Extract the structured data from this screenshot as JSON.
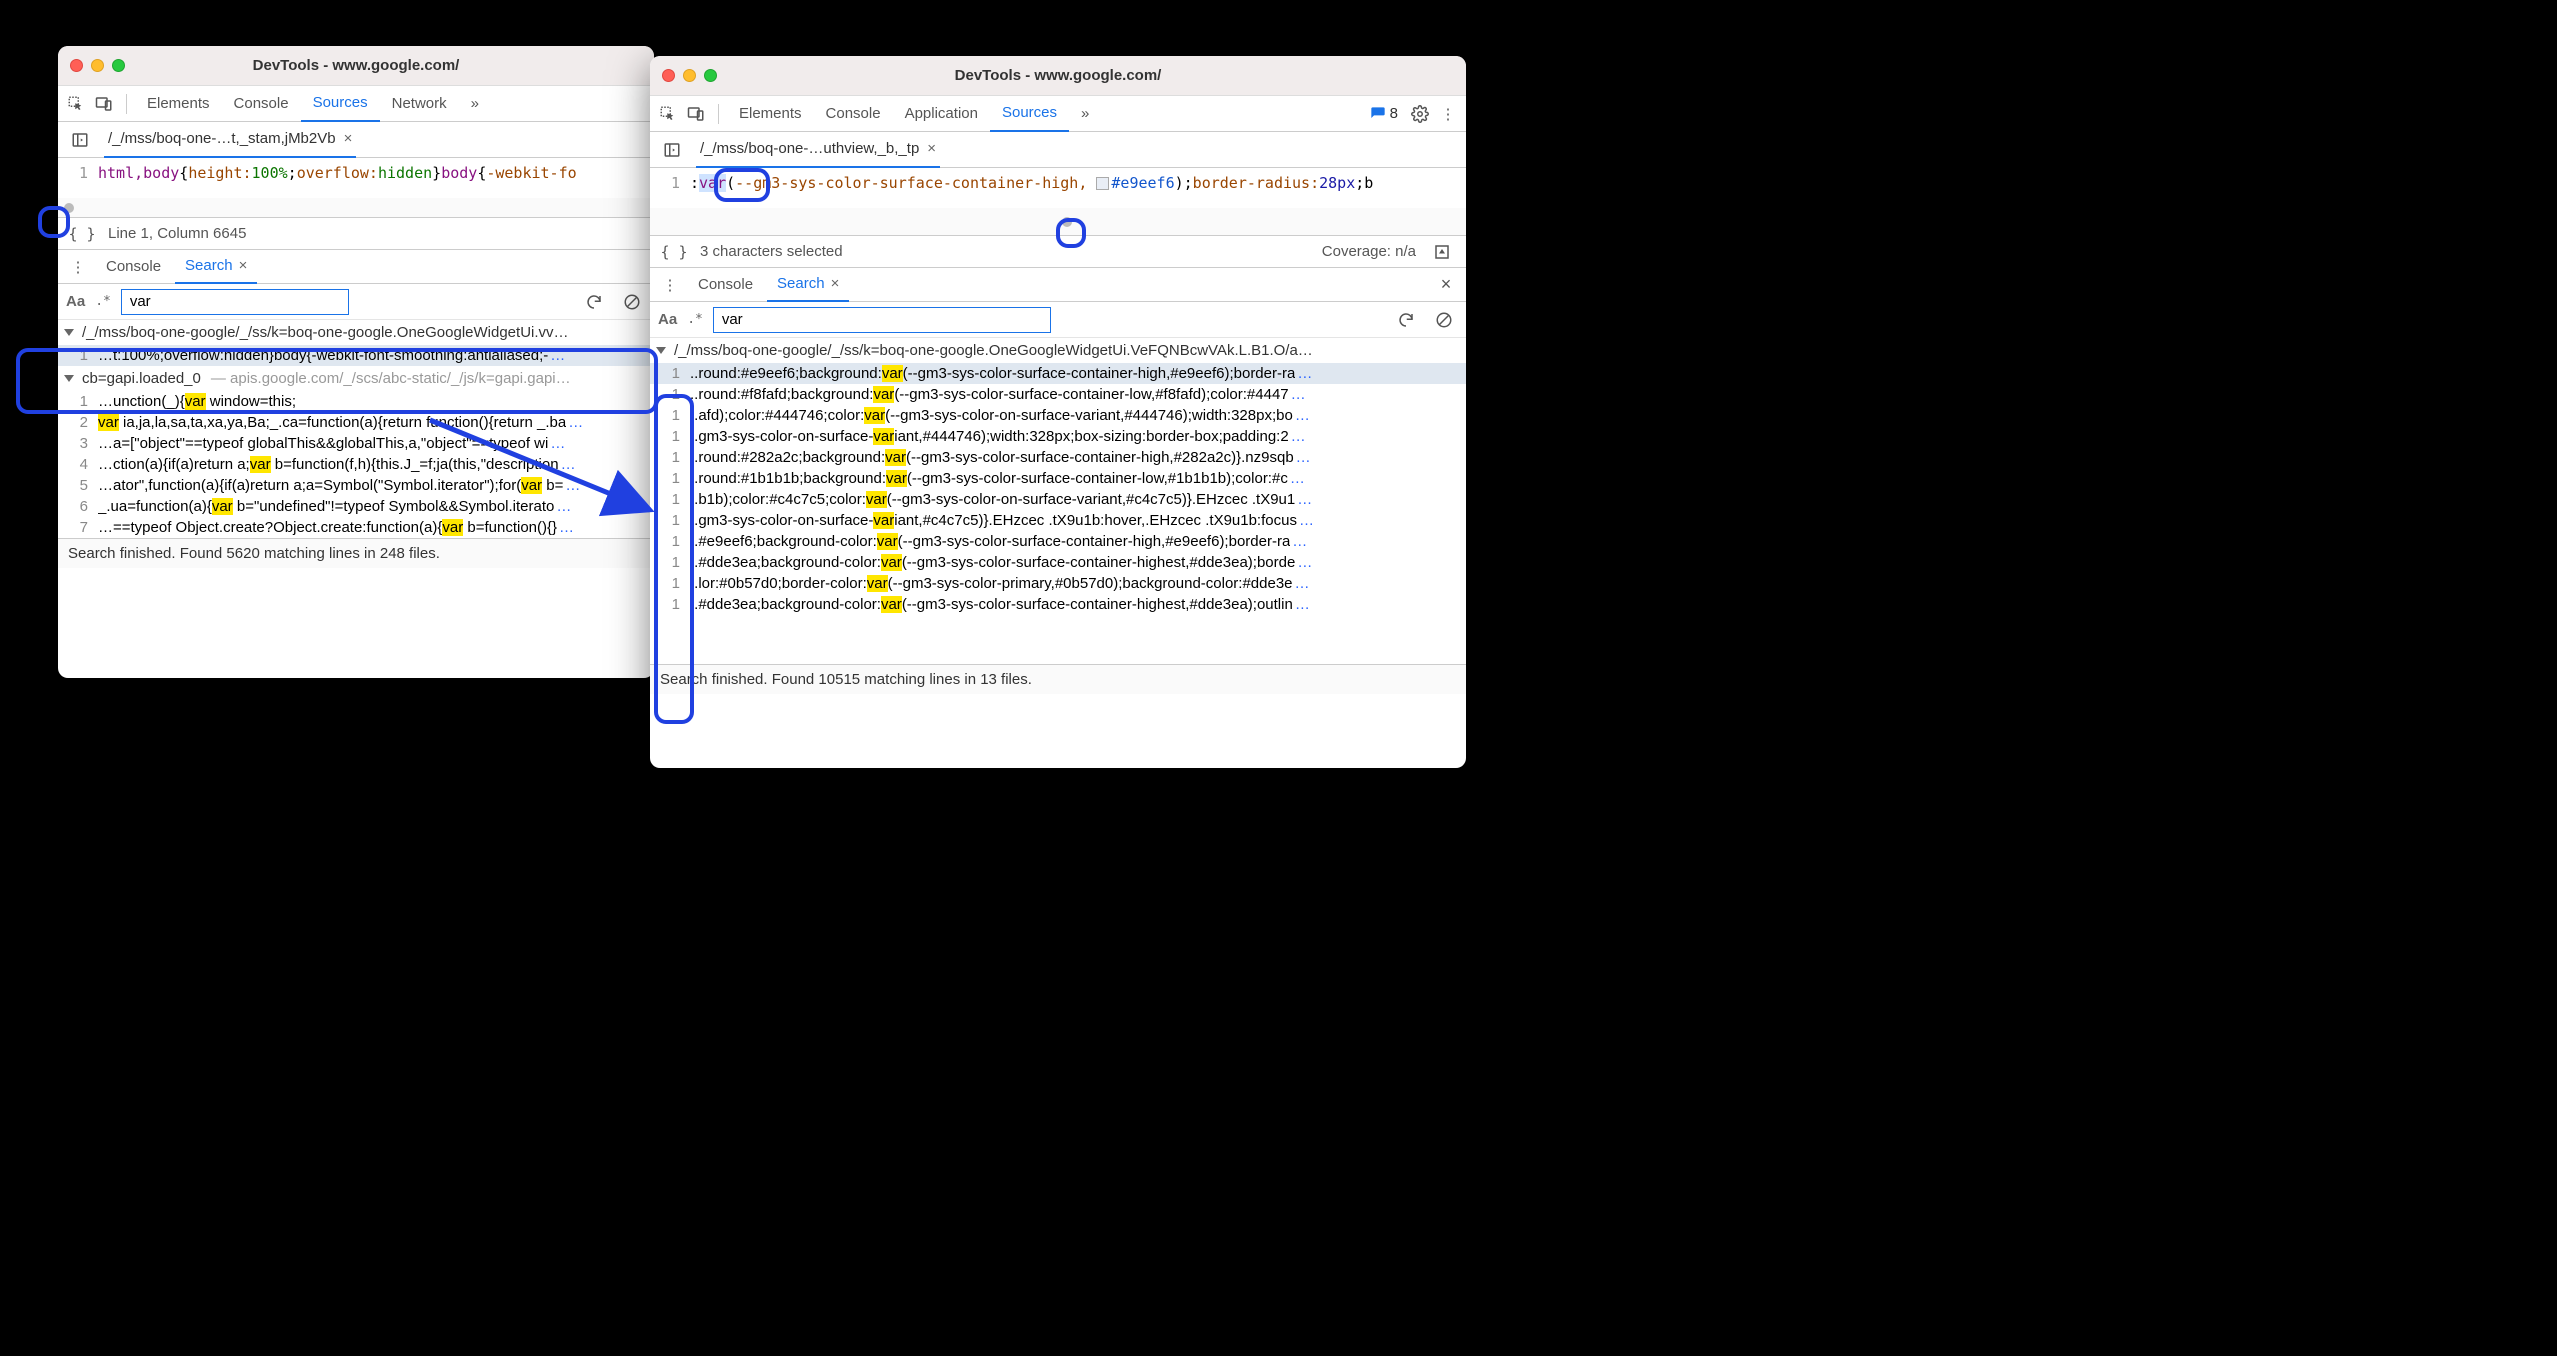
{
  "left": {
    "title": "DevTools - www.google.com/",
    "tabs": {
      "elements": "Elements",
      "console": "Console",
      "sources": "Sources",
      "network": "Network",
      "more": "»"
    },
    "file_tab": "/_/mss/boq-one-…t,_stam,jMb2Vb",
    "code": {
      "ln": "1",
      "seg_tag": "html,body",
      "seg_brace1": "{",
      "seg_prop1": "height:",
      "seg_val1": "100%",
      "seg_semi1": ";",
      "seg_prop2": "overflow:",
      "seg_val2": "hidden",
      "seg_brace2": "}",
      "seg_tag2": "body",
      "seg_brace3": "{",
      "seg_prop3": "-webkit-fo"
    },
    "status": "Line 1, Column 6645",
    "drawer": {
      "console": "Console",
      "search": "Search"
    },
    "search": {
      "Aa": "Aa",
      "regex": ".*",
      "value": "var"
    },
    "groups": [
      {
        "head": "/_/mss/boq-one-google/_/ss/k=boq-one-google.OneGoogleWidgetUi.vv…",
        "rows": [
          {
            "ln": "1",
            "pre": "…t:100%;overflow:hidden}body{-webkit-font-smoothing:antialiased;-",
            "hl": "",
            "post": "",
            "more": "…",
            "sel": true
          }
        ]
      },
      {
        "head": "cb=gapi.loaded_0",
        "sub": "— apis.google.com/_/scs/abc-static/_/js/k=gapi.gapi…",
        "rows": [
          {
            "ln": "1",
            "pre": "…unction(_){",
            "hl": "var",
            "post": " window=this;",
            "more": ""
          },
          {
            "ln": "2",
            "pre": "",
            "hl": "var",
            "post": " ia,ja,la,sa,ta,xa,ya,Ba;_.ca=function(a){return function(){return _.ba",
            "more": "…"
          },
          {
            "ln": "3",
            "pre": "…a=[\"object\"==typeof globalThis&&globalThis,a,\"object\"==typeof wi",
            "hl": "",
            "post": "",
            "more": "…"
          },
          {
            "ln": "4",
            "pre": "…ction(a){if(a)return a;",
            "hl": "var",
            "post": " b=function(f,h){this.J_=f;ja(this,\"description",
            "more": "…"
          },
          {
            "ln": "5",
            "pre": "…ator\",function(a){if(a)return a;a=Symbol(\"Symbol.iterator\");for(",
            "hl": "var",
            "post": " b=",
            "more": "…"
          },
          {
            "ln": "6",
            "pre": "_.ua=function(a){",
            "hl": "var",
            "post": " b=\"undefined\"!=typeof Symbol&&Symbol.iterato",
            "more": "…"
          },
          {
            "ln": "7",
            "pre": "…==typeof Object.create?Object.create:function(a){",
            "hl": "var",
            "post": " b=function(){}",
            "more": "…"
          }
        ]
      }
    ],
    "footer": "Search finished.  Found 5620 matching lines in 248 files."
  },
  "right": {
    "title": "DevTools - www.google.com/",
    "tabs": {
      "elements": "Elements",
      "console": "Console",
      "application": "Application",
      "sources": "Sources",
      "more": "»"
    },
    "badge_count": "8",
    "file_tab": "/_/mss/boq-one-…uthview,_b,_tp",
    "code": {
      "ln": "1",
      "pre": ":",
      "var": "var",
      "open": "(",
      "arg1": "--gm3-sys-color-surface-container-high, ",
      "hex": "#e9eef6",
      "close": ");",
      "prop": "border-radius:",
      "val": "28px",
      "tail": ";b"
    },
    "status_left": "3 characters selected",
    "status_right": "Coverage: n/a",
    "drawer": {
      "console": "Console",
      "search": "Search"
    },
    "search": {
      "Aa": "Aa",
      "regex": ".*",
      "value": "var"
    },
    "group_head": "/_/mss/boq-one-google/_/ss/k=boq-one-google.OneGoogleWidgetUi.VeFQNBcwVAk.L.B1.O/a…",
    "rows": [
      {
        "ln": "1",
        "pre": "..round:#e9eef6;background:",
        "hl": "var",
        "post": "(--gm3-sys-color-surface-container-high,#e9eef6);border-ra",
        "more": "…",
        "sel": true
      },
      {
        "ln": "1",
        "pre": "..round:#f8fafd;background:",
        "hl": "var",
        "post": "(--gm3-sys-color-surface-container-low,#f8fafd);color:#4447",
        "more": "…"
      },
      {
        "ln": "1",
        "pre": "..afd);color:#444746;color:",
        "hl": "var",
        "post": "(--gm3-sys-color-on-surface-variant,#444746);width:328px;bo",
        "more": "…"
      },
      {
        "ln": "1",
        "pre": "..gm3-sys-color-on-surface-",
        "hl": "var",
        "post": "iant,#444746);width:328px;box-sizing:border-box;padding:2",
        "more": "…"
      },
      {
        "ln": "1",
        "pre": "..round:#282a2c;background:",
        "hl": "var",
        "post": "(--gm3-sys-color-surface-container-high,#282a2c)}.nz9sqb",
        "more": "…"
      },
      {
        "ln": "1",
        "pre": "..round:#1b1b1b;background:",
        "hl": "var",
        "post": "(--gm3-sys-color-surface-container-low,#1b1b1b);color:#c",
        "more": "…"
      },
      {
        "ln": "1",
        "pre": "..b1b);color:#c4c7c5;color:",
        "hl": "var",
        "post": "(--gm3-sys-color-on-surface-variant,#c4c7c5)}.EHzcec .tX9u1",
        "more": "…"
      },
      {
        "ln": "1",
        "pre": "..gm3-sys-color-on-surface-",
        "hl": "var",
        "post": "iant,#c4c7c5)}.EHzcec .tX9u1b:hover,.EHzcec .tX9u1b:focus",
        "more": "…"
      },
      {
        "ln": "1",
        "pre": "..#e9eef6;background-color:",
        "hl": "var",
        "post": "(--gm3-sys-color-surface-container-high,#e9eef6);border-ra",
        "more": "…"
      },
      {
        "ln": "1",
        "pre": "..#dde3ea;background-color:",
        "hl": "var",
        "post": "(--gm3-sys-color-surface-container-highest,#dde3ea);borde",
        "more": "…"
      },
      {
        "ln": "1",
        "pre": "..lor:#0b57d0;border-color:",
        "hl": "var",
        "post": "(--gm3-sys-color-primary,#0b57d0);background-color:#dde3e",
        "more": "…"
      },
      {
        "ln": "1",
        "pre": "..#dde3ea;background-color:",
        "hl": "var",
        "post": "(--gm3-sys-color-surface-container-highest,#dde3ea);outlin",
        "more": "…"
      }
    ],
    "footer": "Search finished.  Found 10515 matching lines in 13 files."
  }
}
